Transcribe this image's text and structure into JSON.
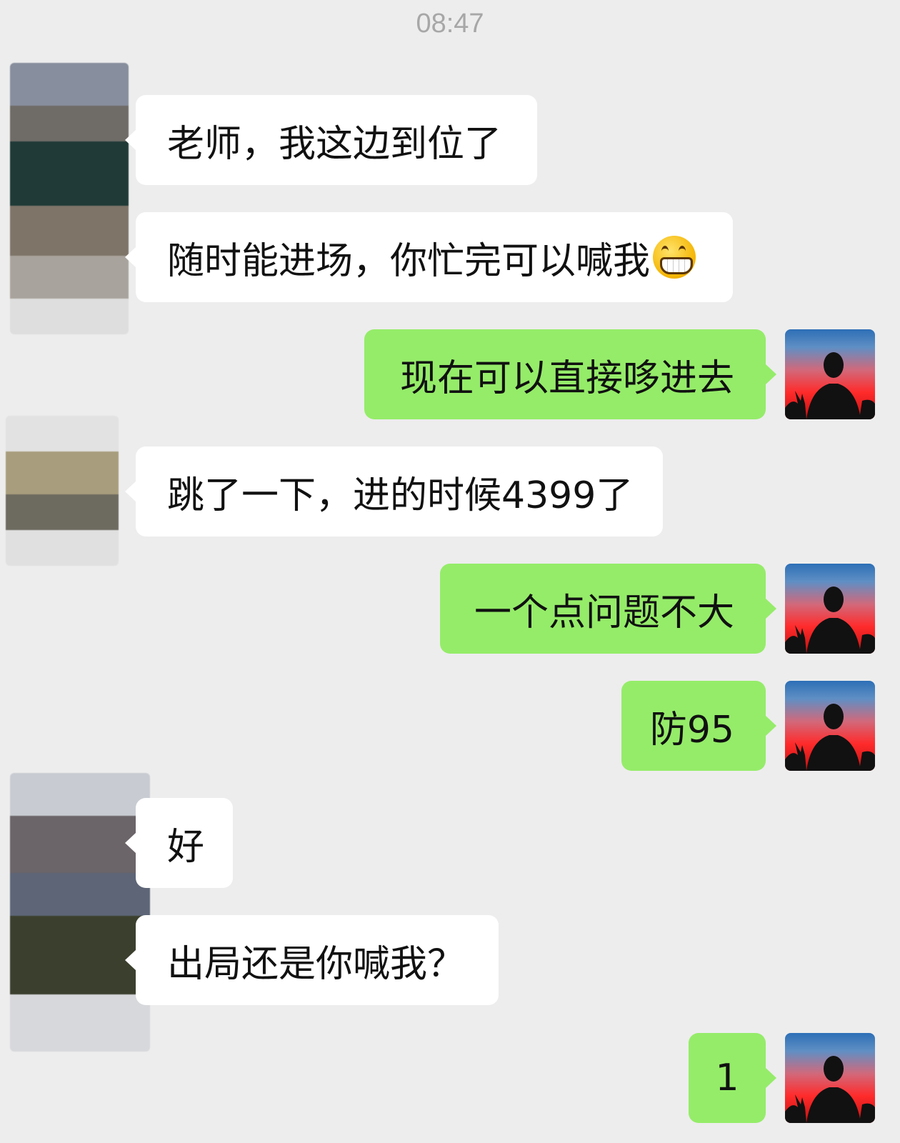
{
  "chat": {
    "timestamp": "08:47",
    "messages": [
      {
        "side": "in",
        "text": "老师，我这边到位了"
      },
      {
        "side": "in",
        "text": "随时能进场，你忙完可以喊我",
        "emoji": "grinning-face-emoji"
      },
      {
        "side": "out",
        "text": "现在可以直接哆进去"
      },
      {
        "side": "in",
        "text": "跳了一下，进的时候4399了"
      },
      {
        "side": "out",
        "text": "一个点问题不大"
      },
      {
        "side": "out",
        "text": "防95"
      },
      {
        "side": "in",
        "text": "好"
      },
      {
        "side": "in",
        "text": "出局还是你喊我？"
      },
      {
        "side": "out",
        "text": "1"
      }
    ]
  },
  "colors": {
    "background": "#ededed",
    "incoming_bubble": "#ffffff",
    "outgoing_bubble": "#95ec69",
    "timestamp_text": "#a7a7a7"
  },
  "icons": {
    "self_avatar": "sunset-silhouette-avatar",
    "other_avatar": "obscured-avatar"
  }
}
